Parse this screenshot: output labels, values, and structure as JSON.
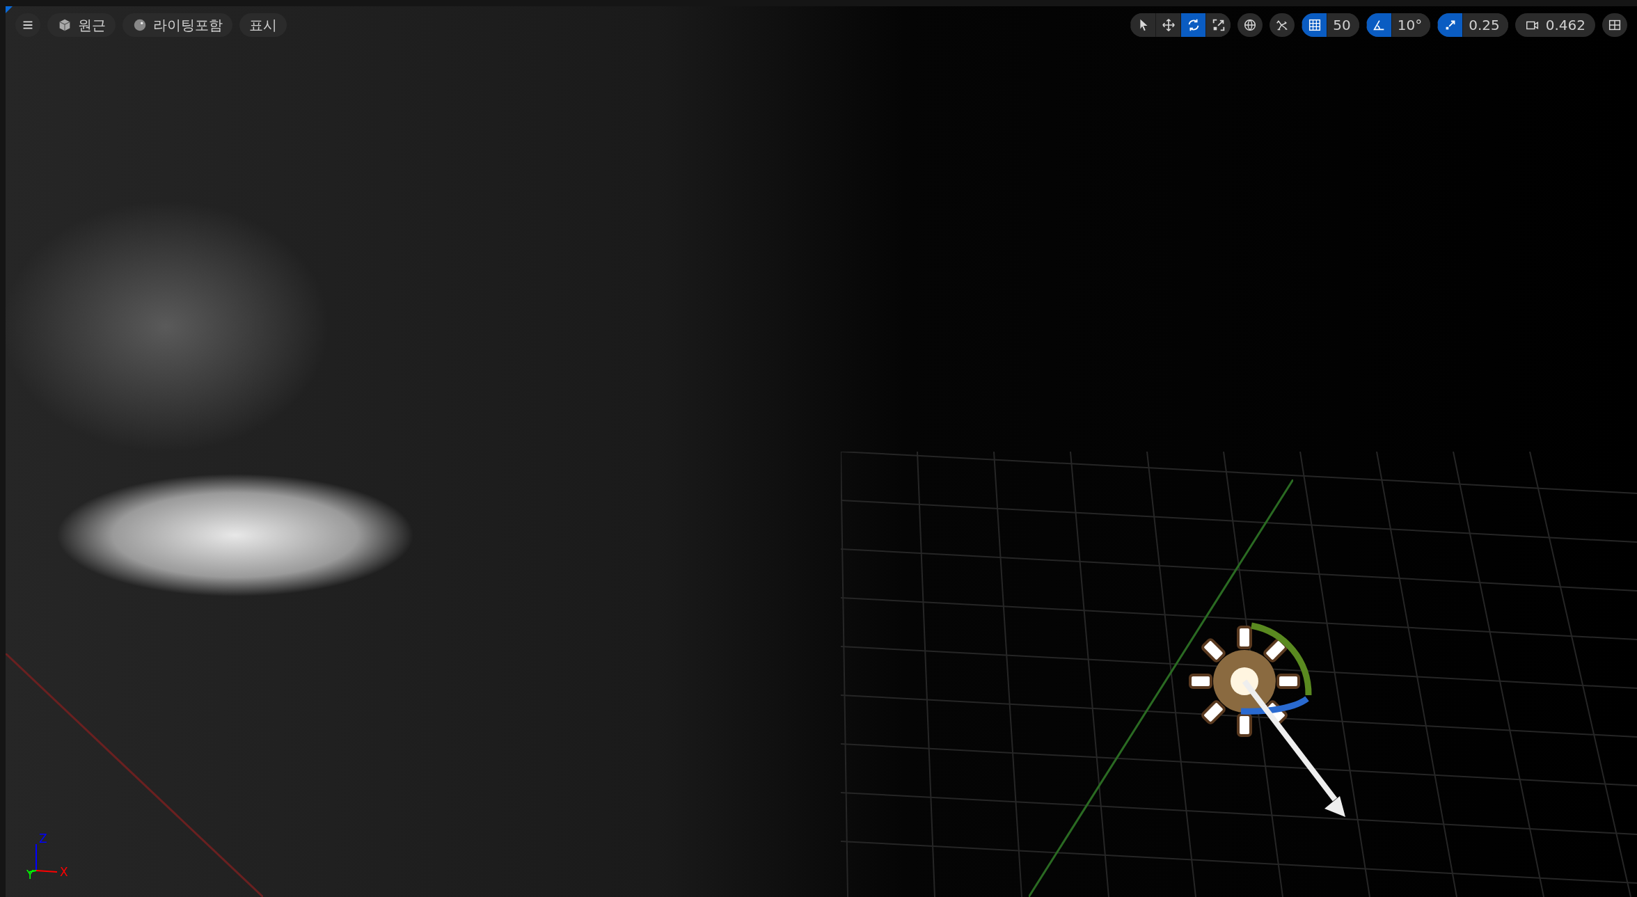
{
  "view_modes": [
    {
      "kind": "perspective",
      "label": "원근"
    },
    {
      "kind": "lit",
      "label": "라이팅포함"
    },
    {
      "kind": "show",
      "label": "표시"
    }
  ],
  "transform_tools": [
    {
      "kind": "select",
      "selected": false
    },
    {
      "kind": "move",
      "selected": false
    },
    {
      "kind": "rotate",
      "selected": true
    },
    {
      "kind": "scale",
      "selected": false
    }
  ],
  "snaps": [
    {
      "kind": "grid",
      "on": true,
      "value": "50"
    },
    {
      "kind": "rotation",
      "on": true,
      "value": "10°"
    },
    {
      "kind": "scale",
      "on": true,
      "value": "0.25"
    }
  ],
  "camera_speed": "0.462",
  "axes": [
    {
      "label": "Z",
      "color": "#0000ff"
    },
    {
      "label": "Y",
      "color": "#00ff00"
    },
    {
      "label": "X",
      "color": "#ff0000"
    }
  ]
}
